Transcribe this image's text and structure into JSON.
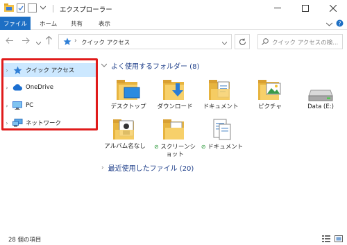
{
  "window": {
    "title": "エクスプローラー"
  },
  "ribbon": {
    "tabs": [
      "ファイル",
      "ホーム",
      "共有",
      "表示"
    ]
  },
  "navigation": {
    "address_text": "クイック アクセス",
    "search_placeholder": "クイック アクセスの検..."
  },
  "sidebar": {
    "items": [
      {
        "label": "クイック アクセス",
        "icon": "star-icon",
        "selected": true
      },
      {
        "label": "OneDrive",
        "icon": "cloud-icon",
        "selected": false
      },
      {
        "label": "PC",
        "icon": "monitor-icon",
        "selected": false
      },
      {
        "label": "ネットワーク",
        "icon": "network-icon",
        "selected": false
      }
    ]
  },
  "frequent": {
    "header": "よく使用するフォルダー (8)",
    "items": [
      {
        "label": "デスクトップ",
        "icon": "desktop-folder-icon"
      },
      {
        "label": "ダウンロード",
        "icon": "download-folder-icon"
      },
      {
        "label": "ドキュメント",
        "icon": "documents-folder-icon"
      },
      {
        "label": "ピクチャ",
        "icon": "pictures-folder-icon"
      },
      {
        "label": "Data (E:)",
        "icon": "drive-icon"
      },
      {
        "label": "アルバム名なし",
        "icon": "album-folder-icon"
      },
      {
        "label": "スクリーンショット",
        "icon": "folder-icon"
      },
      {
        "label": "ドキュメント",
        "icon": "documents-folder-icon"
      }
    ]
  },
  "recent": {
    "header": "最近使用したファイル (20)"
  },
  "status": {
    "item_count": "28 個の項目"
  },
  "colors": {
    "accent": "#1e6fc4",
    "highlight": "#e01b1b",
    "selection": "#cce8ff",
    "folder": "#f3c24a"
  }
}
